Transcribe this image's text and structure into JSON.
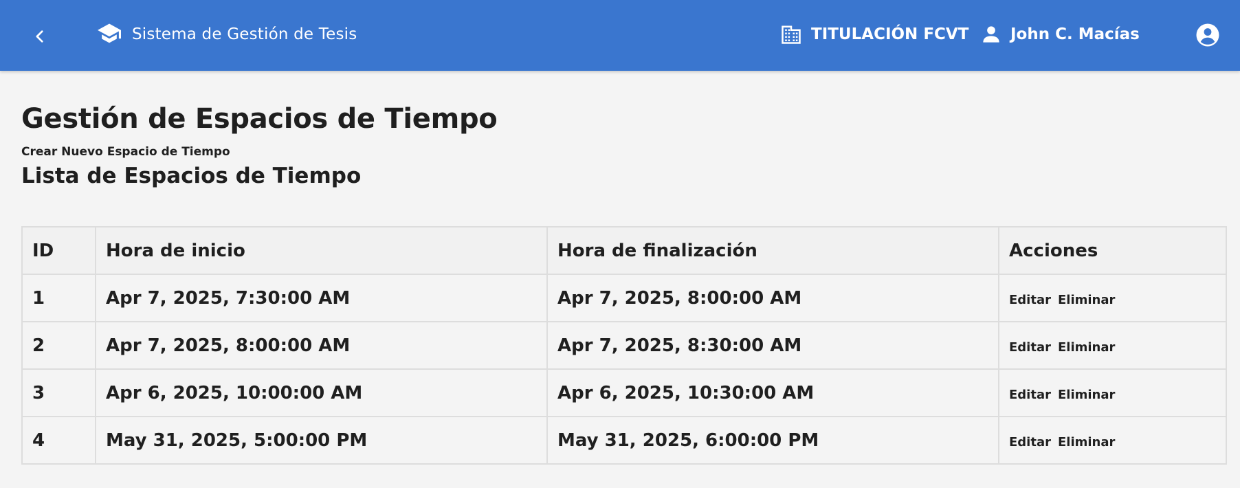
{
  "app": {
    "title": "Sistema de Gestión de Tesis",
    "organization": "TITULACIÓN FCVT",
    "user_name": "John C. Macías",
    "icons": {
      "back": "chevron-left-icon",
      "brand": "graduation-cap-icon",
      "organization": "building-icon",
      "user": "person-icon",
      "account": "account-circle-icon"
    },
    "colors": {
      "header": "#3a76cf",
      "background": "#f4f4f4"
    }
  },
  "page": {
    "title": "Gestión de Espacios de Tiempo",
    "create_link": "Crear Nuevo Espacio de Tiempo",
    "list_title": "Lista de Espacios de Tiempo"
  },
  "table": {
    "headers": [
      "ID",
      "Hora de inicio",
      "Hora de finalización",
      "Acciones"
    ],
    "rows": [
      {
        "id": "1",
        "start": "Apr 7, 2025, 7:30:00 AM",
        "end": "Apr 7, 2025, 8:00:00 AM"
      },
      {
        "id": "2",
        "start": "Apr 7, 2025, 8:00:00 AM",
        "end": "Apr 7, 2025, 8:30:00 AM"
      },
      {
        "id": "3",
        "start": "Apr 6, 2025, 10:00:00 AM",
        "end": "Apr 6, 2025, 10:30:00 AM"
      },
      {
        "id": "4",
        "start": "May 31, 2025, 5:00:00 PM",
        "end": "May 31, 2025, 6:00:00 PM"
      }
    ],
    "actions": {
      "edit": "Editar",
      "delete": "Eliminar"
    }
  }
}
